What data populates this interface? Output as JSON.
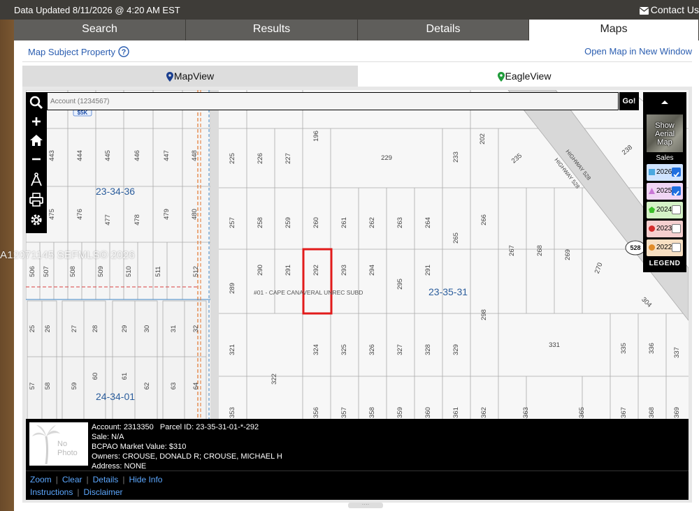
{
  "topbar": {
    "updated": "Data Updated 8/11/2026 @ 4:20 AM EST",
    "contact": "Contact Us"
  },
  "tabs": [
    {
      "label": "Search",
      "active": false
    },
    {
      "label": "Results",
      "active": false
    },
    {
      "label": "Details",
      "active": false
    },
    {
      "label": "Maps",
      "active": true
    }
  ],
  "panel": {
    "subject_link": "Map Subject Property",
    "open_map": "Open Map in New Window"
  },
  "view_tabs": {
    "mapview": "MapView",
    "eagleview": "EagleView"
  },
  "map": {
    "search_placeholder": "Account (1234567)",
    "go_label": "Go!",
    "aerial_label": "Show Aerial Map",
    "sales_label": "Sales",
    "legend_label": "LEGEND",
    "sales_years": [
      {
        "year": "2026",
        "color": "#4aa8e0",
        "checked": true,
        "marker": "square"
      },
      {
        "year": "2025",
        "color": "#c977d6",
        "checked": true,
        "marker": "triangle"
      },
      {
        "year": "2024",
        "color": "#6ccf4a",
        "checked": false,
        "marker": "pentagon"
      },
      {
        "year": "2023",
        "color": "#e56a6a",
        "checked": false,
        "marker": "circle"
      },
      {
        "year": "2022",
        "color": "#e9a75a",
        "checked": false,
        "marker": "circle"
      }
    ],
    "section_labels": [
      "23-34-36",
      "23-35-31",
      "24-34-01"
    ],
    "subdivision_label": "#01 - CAPE CANAVERAL UNREC SUBD",
    "highway_labels": [
      "HIGHWAY 528",
      "HIGHWAY 528"
    ],
    "route_shield": "528",
    "badge_label": "$5K",
    "highlight_parcel": "292",
    "parcel_labels": {
      "row1": [
        "443",
        "444",
        "445",
        "446",
        "447",
        "448"
      ],
      "row1b": [
        "225",
        "226",
        "227",
        "196",
        "229",
        "233",
        "202",
        "235",
        "238"
      ],
      "row2": [
        "475",
        "476",
        "477",
        "478",
        "479",
        "480",
        "257",
        "258",
        "259",
        "260",
        "261",
        "262",
        "263",
        "264",
        "265",
        "266"
      ],
      "row3": [
        "506",
        "507",
        "508",
        "509",
        "510",
        "511",
        "512",
        "289",
        "290",
        "291",
        "292",
        "293",
        "294",
        "295",
        "291",
        "267",
        "268",
        "269",
        "270",
        "304"
      ],
      "row4": [
        "25",
        "26",
        "27",
        "28",
        "29",
        "30",
        "31",
        "32",
        "321",
        "324",
        "325",
        "326",
        "327",
        "328",
        "329",
        "298",
        "331",
        "335",
        "336",
        "337"
      ],
      "row5": [
        "57",
        "58",
        "59",
        "60",
        "61",
        "62",
        "63",
        "64",
        "322",
        "353",
        "356",
        "357",
        "358",
        "359",
        "360",
        "361",
        "362",
        "363",
        "365",
        "367",
        "368",
        "369"
      ]
    }
  },
  "info": {
    "account_label": "Account:",
    "account_value": "2313350",
    "parcel_label": "Parcel ID:",
    "parcel_value": "23-35-31-01-*-292",
    "sale_label": "Sale:",
    "sale_value": "N/A",
    "market_label": "BCPAO Market Value:",
    "market_value": "$310",
    "owners_label": "Owners:",
    "owners_value": "CROUSE, DONALD R; CROUSE, MICHAEL H",
    "address_label": "Address:",
    "address_value": "NONE",
    "nophoto_label": "No Photo",
    "links": [
      "Zoom",
      "Clear",
      "Details",
      "Hide Info"
    ],
    "links2": [
      "Instructions",
      "Disclaimer"
    ]
  },
  "watermark": "A12071145  SEFMLS© 2026"
}
